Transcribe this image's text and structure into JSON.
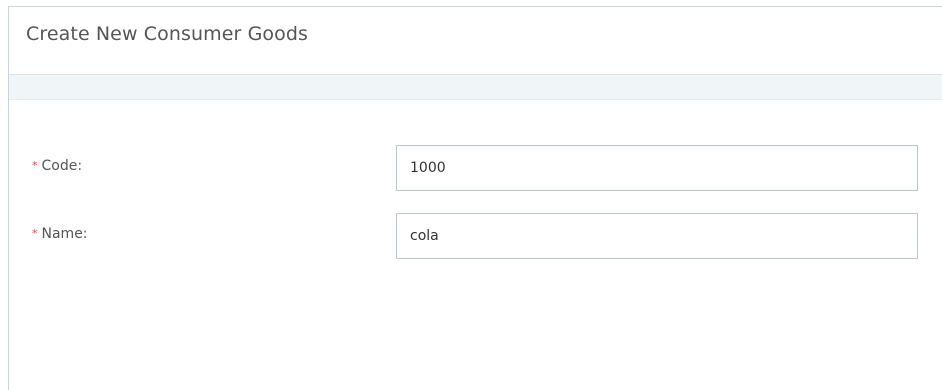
{
  "header": {
    "title": "Create New Consumer Goods"
  },
  "form": {
    "required_marker": "*",
    "fields": [
      {
        "label": "Code:",
        "value": "1000"
      },
      {
        "label": "Name:",
        "value": "cola"
      }
    ]
  },
  "colors": {
    "required": "#e04545",
    "border": "#bcc3ca",
    "strip": "#f0f5f8"
  }
}
